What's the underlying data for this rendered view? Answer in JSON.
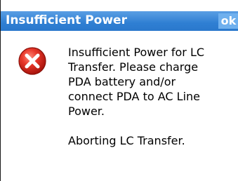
{
  "dialog": {
    "title": "Insufficient Power",
    "ok_label": "ok",
    "icon": "error-icon",
    "message_lines": [
      "Insufficient Power for LC",
      "Transfer.  Please charge",
      "PDA battery and/or",
      "connect PDA to AC Line",
      "Power."
    ],
    "abort_message": "Aborting LC Transfer."
  },
  "colors": {
    "title_bar": "#2f7fd3",
    "ok_button": "#6fb0ee",
    "error_icon": "#d9261c"
  }
}
